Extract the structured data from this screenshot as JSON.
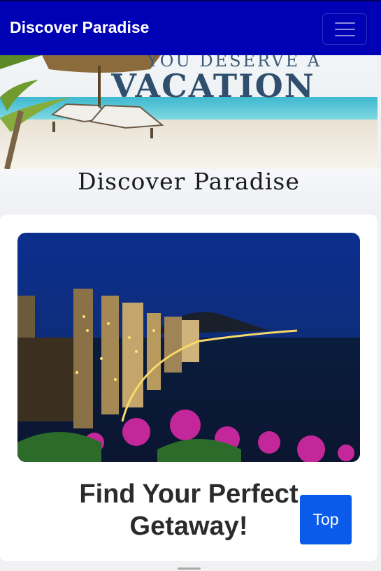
{
  "navbar": {
    "brand": "Discover Paradise",
    "toggler_icon": "hamburger-menu-icon"
  },
  "hero": {
    "banner_tagline": "YOU DESERVE A",
    "banner_title": "VACATION"
  },
  "page": {
    "subtitle": "Discover Paradise"
  },
  "card": {
    "headline": "Find Your Perfect Getaway!"
  },
  "floating": {
    "top_label": "Top"
  },
  "colors": {
    "navbar_bg": "#0000b5",
    "top_button_bg": "#0a5bea"
  }
}
